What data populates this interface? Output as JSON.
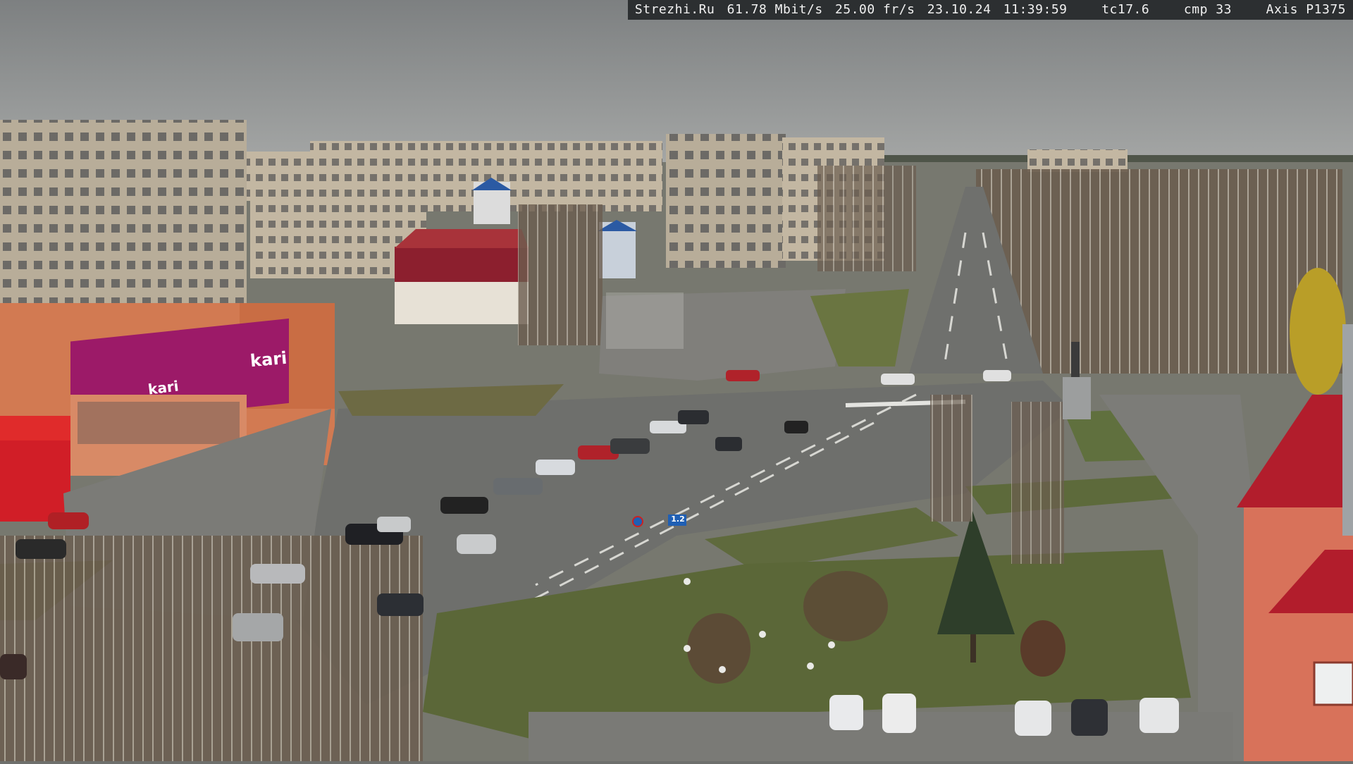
{
  "camera_overlay": {
    "site": "Strezhi.Ru",
    "bitrate": "61.78 Mbit/s",
    "framerate": "25.00 fr/s",
    "date": "23.10.24",
    "time": "11:39:59",
    "tc": "tc17.6",
    "cmp": "cmp 33",
    "model": "Axis P1375"
  },
  "store_sign": {
    "brand": "kari",
    "brand_secondary": "kari"
  },
  "road_sign": {
    "text": "1.2"
  },
  "palette": {
    "sky": "#8d9091",
    "road": "#6f706e",
    "grass": "#5c6a3b",
    "panel_building": "#b5aa97",
    "orange_building": "#d8774e",
    "kari_magenta": "#9c1a68",
    "red_roof": "#b21d2c"
  }
}
